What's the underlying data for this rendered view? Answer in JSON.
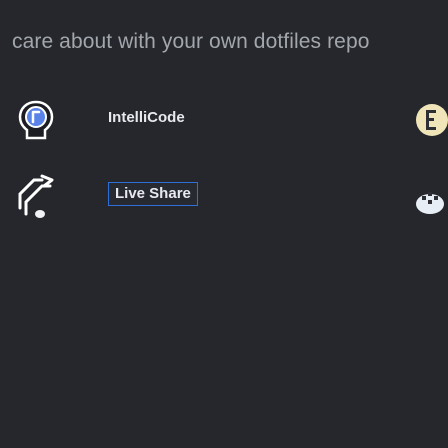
{
  "header": {
    "text": "care about with your own dotfiles repo"
  },
  "extensions": [
    {
      "name": "IntelliCode",
      "icon": "intellicode-bulb-icon",
      "right_icon": "partial-extension-icon",
      "highlighted": false
    },
    {
      "name": "Live Share",
      "icon": "live-share-arrow-icon",
      "right_icon": "partial-extension-icon",
      "highlighted": true
    }
  ],
  "colors": {
    "background": "#25272c",
    "heading_text": "#a2a6ad",
    "label_text": "#e7e9ee",
    "highlight_border": "#2f6fd6",
    "intellicode_blue": "#5a83e8",
    "icon_outline": "#ffffff"
  }
}
